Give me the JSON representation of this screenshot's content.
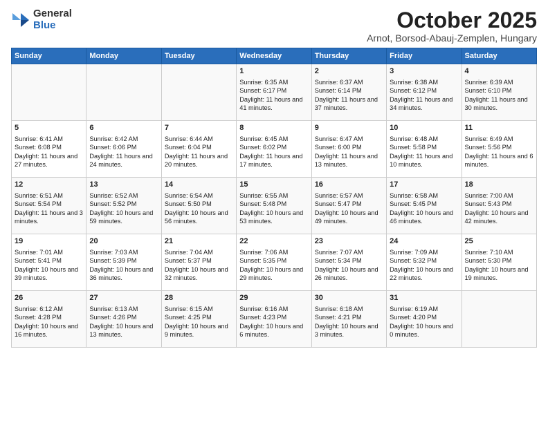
{
  "logo": {
    "general": "General",
    "blue": "Blue"
  },
  "title": "October 2025",
  "location": "Arnot, Borsod-Abauj-Zemplen, Hungary",
  "headers": [
    "Sunday",
    "Monday",
    "Tuesday",
    "Wednesday",
    "Thursday",
    "Friday",
    "Saturday"
  ],
  "weeks": [
    [
      {
        "day": "",
        "content": ""
      },
      {
        "day": "",
        "content": ""
      },
      {
        "day": "",
        "content": ""
      },
      {
        "day": "1",
        "content": "Sunrise: 6:35 AM\nSunset: 6:17 PM\nDaylight: 11 hours and 41 minutes."
      },
      {
        "day": "2",
        "content": "Sunrise: 6:37 AM\nSunset: 6:14 PM\nDaylight: 11 hours and 37 minutes."
      },
      {
        "day": "3",
        "content": "Sunrise: 6:38 AM\nSunset: 6:12 PM\nDaylight: 11 hours and 34 minutes."
      },
      {
        "day": "4",
        "content": "Sunrise: 6:39 AM\nSunset: 6:10 PM\nDaylight: 11 hours and 30 minutes."
      }
    ],
    [
      {
        "day": "5",
        "content": "Sunrise: 6:41 AM\nSunset: 6:08 PM\nDaylight: 11 hours and 27 minutes."
      },
      {
        "day": "6",
        "content": "Sunrise: 6:42 AM\nSunset: 6:06 PM\nDaylight: 11 hours and 24 minutes."
      },
      {
        "day": "7",
        "content": "Sunrise: 6:44 AM\nSunset: 6:04 PM\nDaylight: 11 hours and 20 minutes."
      },
      {
        "day": "8",
        "content": "Sunrise: 6:45 AM\nSunset: 6:02 PM\nDaylight: 11 hours and 17 minutes."
      },
      {
        "day": "9",
        "content": "Sunrise: 6:47 AM\nSunset: 6:00 PM\nDaylight: 11 hours and 13 minutes."
      },
      {
        "day": "10",
        "content": "Sunrise: 6:48 AM\nSunset: 5:58 PM\nDaylight: 11 hours and 10 minutes."
      },
      {
        "day": "11",
        "content": "Sunrise: 6:49 AM\nSunset: 5:56 PM\nDaylight: 11 hours and 6 minutes."
      }
    ],
    [
      {
        "day": "12",
        "content": "Sunrise: 6:51 AM\nSunset: 5:54 PM\nDaylight: 11 hours and 3 minutes."
      },
      {
        "day": "13",
        "content": "Sunrise: 6:52 AM\nSunset: 5:52 PM\nDaylight: 10 hours and 59 minutes."
      },
      {
        "day": "14",
        "content": "Sunrise: 6:54 AM\nSunset: 5:50 PM\nDaylight: 10 hours and 56 minutes."
      },
      {
        "day": "15",
        "content": "Sunrise: 6:55 AM\nSunset: 5:48 PM\nDaylight: 10 hours and 53 minutes."
      },
      {
        "day": "16",
        "content": "Sunrise: 6:57 AM\nSunset: 5:47 PM\nDaylight: 10 hours and 49 minutes."
      },
      {
        "day": "17",
        "content": "Sunrise: 6:58 AM\nSunset: 5:45 PM\nDaylight: 10 hours and 46 minutes."
      },
      {
        "day": "18",
        "content": "Sunrise: 7:00 AM\nSunset: 5:43 PM\nDaylight: 10 hours and 42 minutes."
      }
    ],
    [
      {
        "day": "19",
        "content": "Sunrise: 7:01 AM\nSunset: 5:41 PM\nDaylight: 10 hours and 39 minutes."
      },
      {
        "day": "20",
        "content": "Sunrise: 7:03 AM\nSunset: 5:39 PM\nDaylight: 10 hours and 36 minutes."
      },
      {
        "day": "21",
        "content": "Sunrise: 7:04 AM\nSunset: 5:37 PM\nDaylight: 10 hours and 32 minutes."
      },
      {
        "day": "22",
        "content": "Sunrise: 7:06 AM\nSunset: 5:35 PM\nDaylight: 10 hours and 29 minutes."
      },
      {
        "day": "23",
        "content": "Sunrise: 7:07 AM\nSunset: 5:34 PM\nDaylight: 10 hours and 26 minutes."
      },
      {
        "day": "24",
        "content": "Sunrise: 7:09 AM\nSunset: 5:32 PM\nDaylight: 10 hours and 22 minutes."
      },
      {
        "day": "25",
        "content": "Sunrise: 7:10 AM\nSunset: 5:30 PM\nDaylight: 10 hours and 19 minutes."
      }
    ],
    [
      {
        "day": "26",
        "content": "Sunrise: 6:12 AM\nSunset: 4:28 PM\nDaylight: 10 hours and 16 minutes."
      },
      {
        "day": "27",
        "content": "Sunrise: 6:13 AM\nSunset: 4:26 PM\nDaylight: 10 hours and 13 minutes."
      },
      {
        "day": "28",
        "content": "Sunrise: 6:15 AM\nSunset: 4:25 PM\nDaylight: 10 hours and 9 minutes."
      },
      {
        "day": "29",
        "content": "Sunrise: 6:16 AM\nSunset: 4:23 PM\nDaylight: 10 hours and 6 minutes."
      },
      {
        "day": "30",
        "content": "Sunrise: 6:18 AM\nSunset: 4:21 PM\nDaylight: 10 hours and 3 minutes."
      },
      {
        "day": "31",
        "content": "Sunrise: 6:19 AM\nSunset: 4:20 PM\nDaylight: 10 hours and 0 minutes."
      },
      {
        "day": "",
        "content": ""
      }
    ]
  ]
}
